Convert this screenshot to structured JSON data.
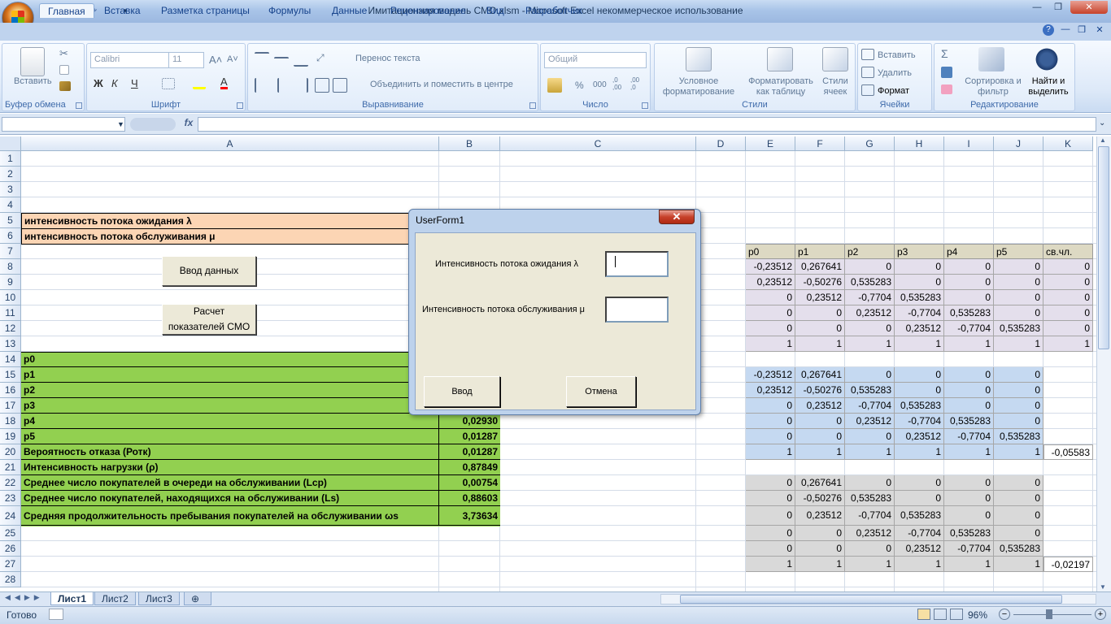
{
  "window": {
    "title": "Имитационная модель СМО.xlsm - Microsoft Excel некоммерческое использование"
  },
  "tabs": [
    "Главная",
    "Вставка",
    "Разметка страницы",
    "Формулы",
    "Данные",
    "Рецензирование",
    "Вид",
    "Разработчик"
  ],
  "ribbon": {
    "clipboard": {
      "label": "Буфер обмена",
      "paste": "Вставить"
    },
    "font": {
      "label": "Шрифт",
      "name": "Calibri",
      "size": "11",
      "bold": "Ж",
      "italic": "К",
      "underline": "Ч"
    },
    "alignment": {
      "label": "Выравнивание",
      "wrap": "Перенос текста",
      "merge": "Объединить и поместить в центре"
    },
    "number": {
      "label": "Число",
      "format": "Общий",
      "percent": "%",
      "thousands": "000",
      "inc": ",0\n,00",
      "dec": ",00\n,0"
    },
    "styles": {
      "label": "Стили",
      "conditional": "Условное форматирование",
      "table": "Форматировать как таблицу",
      "cell_styles": "Стили ячеек"
    },
    "cells": {
      "label": "Ячейки",
      "insert": "Вставить",
      "delete": "Удалить",
      "format": "Формат"
    },
    "editing": {
      "label": "Редактирование",
      "sum": "Σ",
      "sort": "Сортировка и фильтр",
      "find": "Найти и выделить"
    }
  },
  "formula_bar": {
    "fx": "fx",
    "name": "",
    "value": ""
  },
  "columns": [
    "A",
    "B",
    "C",
    "D",
    "E",
    "F",
    "G",
    "H",
    "I",
    "J",
    "K"
  ],
  "rows": [
    "1",
    "2",
    "3",
    "4",
    "5",
    "6",
    "7",
    "8",
    "9",
    "10",
    "11",
    "12",
    "13",
    "14",
    "15",
    "16",
    "17",
    "18",
    "19",
    "20",
    "21",
    "22",
    "23",
    "24",
    "25",
    "26",
    "27",
    "28"
  ],
  "cells": {
    "a5": "интенсивность потока ожидания λ",
    "a6": "интенсивность потока обслуживания μ",
    "a14": "p0",
    "a15": "p1",
    "a16": "p2",
    "a17": "p3",
    "a18": "p4",
    "a19": "p5",
    "a20": "Вероятность отказа (Ротк)",
    "a21": "Интенсивность нагрузки (ρ)",
    "a22": "Среднее число покупателей в очереди на обслуживании (Lср)",
    "a23": "Среднее число покупателей, находящихся на обслуживании (Ls)",
    "a24": "Средняя продолжительность пребывания покупателей на обслуживании ωs",
    "b18": "0,02930",
    "b19": "0,01287",
    "b20": "0,01287",
    "b21": "0,87849",
    "b22": "0,00754",
    "b23": "0,88603",
    "b24": "3,73634"
  },
  "buttons": {
    "input": "Ввод данных",
    "calc": "Расчет показателей СМО"
  },
  "matrix_header": [
    "p0",
    "p1",
    "p2",
    "p3",
    "p4",
    "p5",
    "св.чл."
  ],
  "matrix1": [
    [
      "-0,23512",
      "0,267641",
      "0",
      "0",
      "0",
      "0",
      "0"
    ],
    [
      "0,23512",
      "-0,50276",
      "0,535283",
      "0",
      "0",
      "0",
      "0"
    ],
    [
      "0",
      "0,23512",
      "-0,7704",
      "0,535283",
      "0",
      "0",
      "0"
    ],
    [
      "0",
      "0",
      "0,23512",
      "-0,7704",
      "0,535283",
      "0",
      "0"
    ],
    [
      "0",
      "0",
      "0",
      "0,23512",
      "-0,7704",
      "0,535283",
      "0"
    ],
    [
      "1",
      "1",
      "1",
      "1",
      "1",
      "1",
      "1"
    ]
  ],
  "matrix2": [
    [
      "-0,23512",
      "0,267641",
      "0",
      "0",
      "0",
      "0"
    ],
    [
      "0,23512",
      "-0,50276",
      "0,535283",
      "0",
      "0",
      "0"
    ],
    [
      "0",
      "0,23512",
      "-0,7704",
      "0,535283",
      "0",
      "0"
    ],
    [
      "0",
      "0",
      "0,23512",
      "-0,7704",
      "0,535283",
      "0"
    ],
    [
      "0",
      "0",
      "0",
      "0,23512",
      "-0,7704",
      "0,535283"
    ],
    [
      "1",
      "1",
      "1",
      "1",
      "1",
      "1"
    ]
  ],
  "matrix2_extra": "-0,05583",
  "matrix3": [
    [
      "0",
      "0,267641",
      "0",
      "0",
      "0",
      "0"
    ],
    [
      "0",
      "-0,50276",
      "0,535283",
      "0",
      "0",
      "0"
    ],
    [
      "0",
      "0,23512",
      "-0,7704",
      "0,535283",
      "0",
      "0"
    ],
    [
      "0",
      "0",
      "0,23512",
      "-0,7704",
      "0,535283",
      "0"
    ],
    [
      "0",
      "0",
      "0",
      "0,23512",
      "-0,7704",
      "0,535283"
    ],
    [
      "1",
      "1",
      "1",
      "1",
      "1",
      "1"
    ]
  ],
  "matrix3_extra": "-0,02197",
  "sheets": [
    "Лист1",
    "Лист2",
    "Лист3"
  ],
  "status": {
    "ready": "Готово",
    "zoom": "96%"
  },
  "userform": {
    "title": "UserForm1",
    "close": "✕",
    "label1": "Интенсивность потока ожидания λ",
    "label2": "Интенсивность потока обслуживания μ",
    "value1": "",
    "value2": "",
    "ok": "Ввод",
    "cancel": "Отмена"
  }
}
